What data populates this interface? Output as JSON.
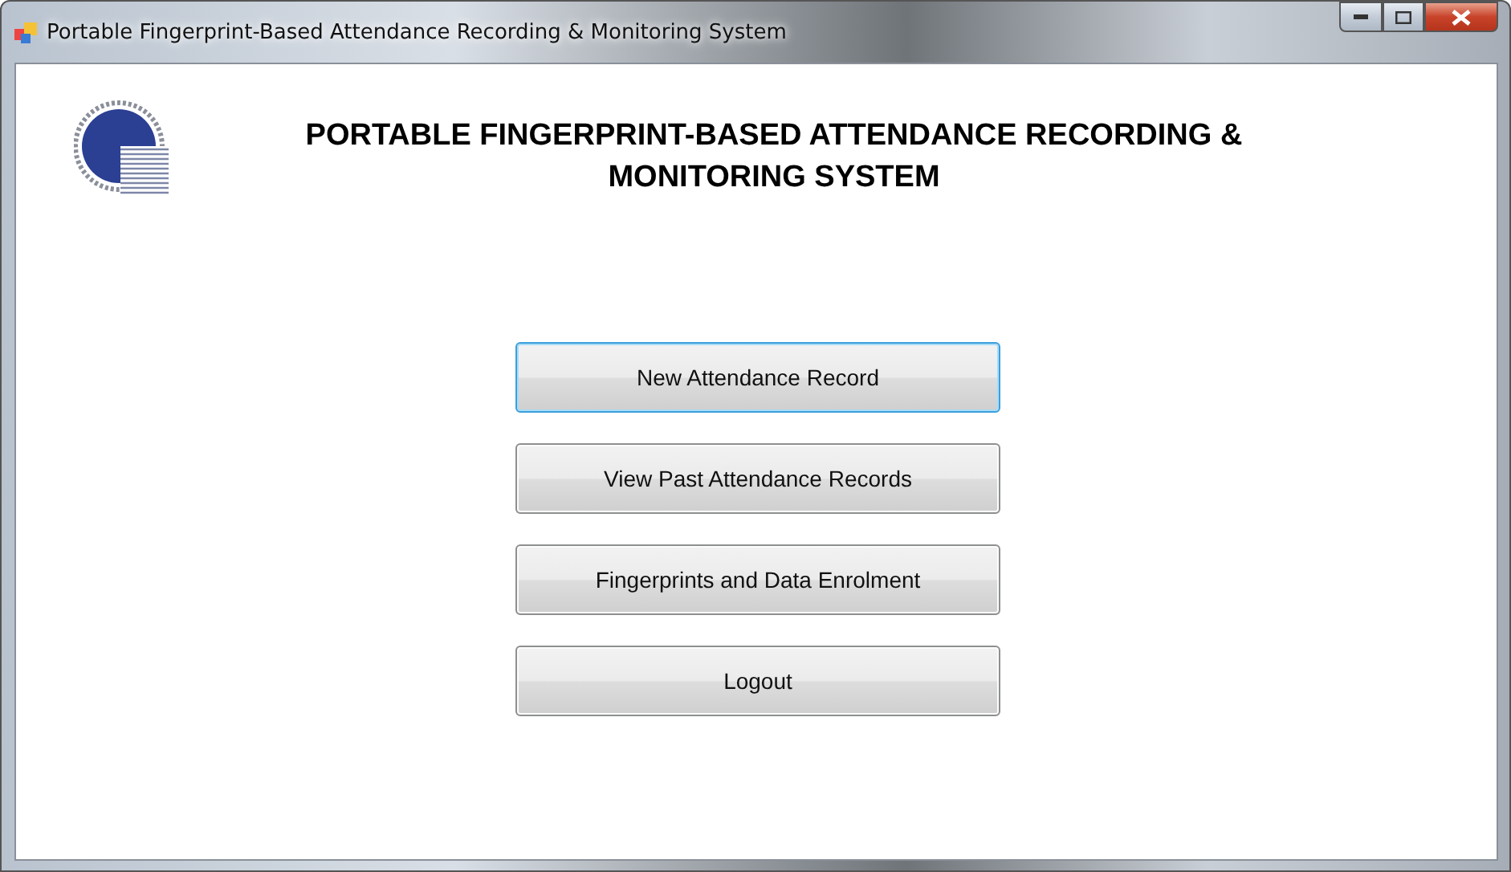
{
  "window": {
    "title": "Portable Fingerprint-Based Attendance Recording & Monitoring System"
  },
  "heading": "PORTABLE FINGERPRINT-BASED ATTENDANCE RECORDING & MONITORING SYSTEM",
  "buttons": [
    {
      "label": "New Attendance Record",
      "selected": true
    },
    {
      "label": "View Past Attendance Records",
      "selected": false
    },
    {
      "label": "Fingerprints and Data Enrolment",
      "selected": false
    },
    {
      "label": "Logout",
      "selected": false
    }
  ]
}
